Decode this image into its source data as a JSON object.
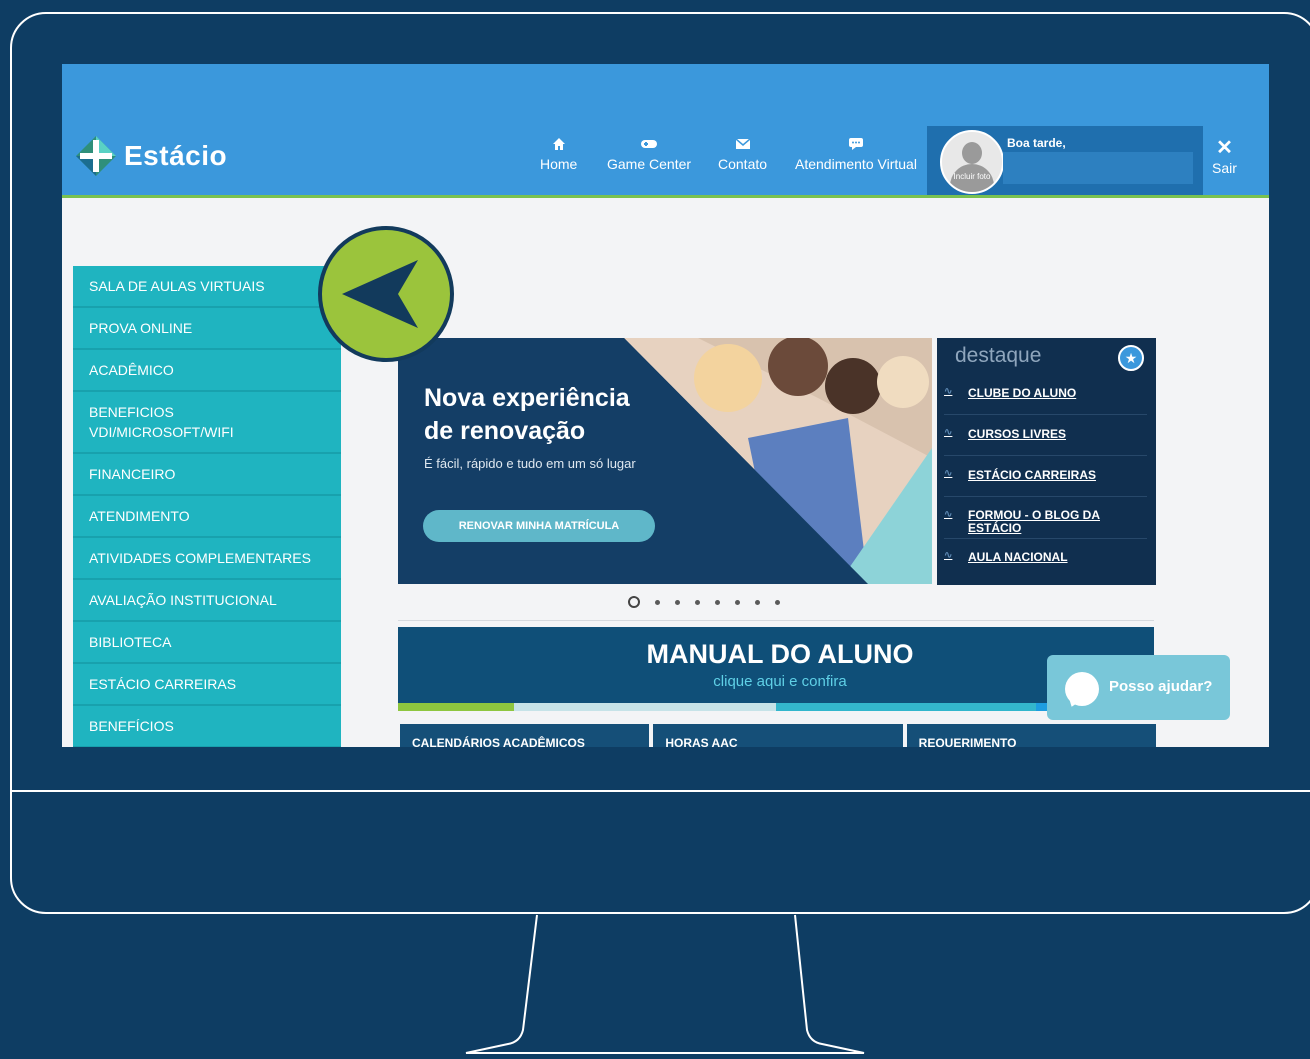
{
  "header": {
    "logo_text": "Estácio",
    "nav": [
      {
        "label": "Home",
        "icon": "home-icon"
      },
      {
        "label": "Game Center",
        "icon": "gamepad-icon"
      },
      {
        "label": "Contato",
        "icon": "mail-icon"
      },
      {
        "label": "Atendimento Virtual",
        "icon": "chat-icon"
      }
    ],
    "user": {
      "greeting": "Boa tarde,",
      "photo_label": "Incluir foto"
    },
    "logout_label": "Sair"
  },
  "sidebar": {
    "items": [
      "SALA DE AULAS VIRTUAIS",
      "PROVA ONLINE",
      "ACADÊMICO",
      "BENEFICIOS VDI/MICROSOFT/WIFI",
      "FINANCEIRO",
      "ATENDIMENTO",
      "ATIVIDADES COMPLEMENTARES",
      "AVALIAÇÃO INSTITUCIONAL",
      "BIBLIOTECA",
      "ESTÁCIO CARREIRAS",
      "BENEFÍCIOS"
    ]
  },
  "banner": {
    "title": "Nova experiência\nde renovação",
    "subtitle": "É fácil, rápido e tudo em um só lugar",
    "button": "RENOVAR MINHA MATRÍCULA"
  },
  "destaque": {
    "title": "destaque",
    "links": [
      "CLUBE DO ALUNO",
      "CURSOS LIVRES",
      "ESTÁCIO CARREIRAS",
      "FORMOU - O BLOG DA ESTÁCIO",
      "AULA NACIONAL"
    ]
  },
  "carousel": {
    "total": 8,
    "active": 0
  },
  "manual": {
    "title": "MANUAL DO ALUNO",
    "subtitle": "clique aqui e confira"
  },
  "tabs": [
    "CALENDÁRIOS ACADÊMICOS",
    "HORAS AAC",
    "REQUERIMENTO"
  ],
  "chat": {
    "label": "Posso ajudar?"
  },
  "colors": {
    "background": "#0e3d63",
    "header": "#3b98dc",
    "sidebar": "#1fb4c0",
    "accent_green": "#9bc43c",
    "navy": "#143e66"
  }
}
